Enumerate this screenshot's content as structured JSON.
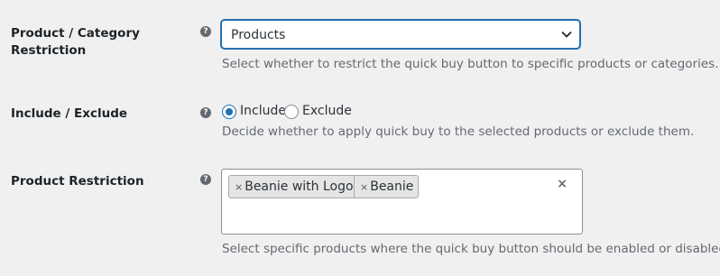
{
  "rows": [
    {
      "label": "Product / Category Restriction",
      "label_line1": "Product / Category",
      "label_line2": "Restriction",
      "help": "?",
      "select": {
        "value": "Products"
      },
      "description": "Select whether to restrict the quick buy button to specific products or categories."
    },
    {
      "label": "Include / Exclude",
      "help": "?",
      "options": [
        {
          "label": "Include",
          "checked": true
        },
        {
          "label": "Exclude",
          "checked": false
        }
      ],
      "description": "Decide whether to apply quick buy to the selected products or exclude them."
    },
    {
      "label": "Product Restriction",
      "help": "?",
      "tags": [
        {
          "remove": "×",
          "label": "Beanie with Logo"
        },
        {
          "remove": "×",
          "label": "Beanie"
        }
      ],
      "clear": "×",
      "description": "Select specific products where the quick buy button should be enabled or disabled."
    }
  ],
  "colors": {
    "background": "#f0f0f1",
    "accent": "#2271b1",
    "description_text": "#646970",
    "tag_background": "#e5e5e5"
  },
  "icons": {
    "help": "help-icon",
    "select_arrow": "chevron-down-icon",
    "tag_remove": "close-icon",
    "clear_all": "close-icon"
  }
}
